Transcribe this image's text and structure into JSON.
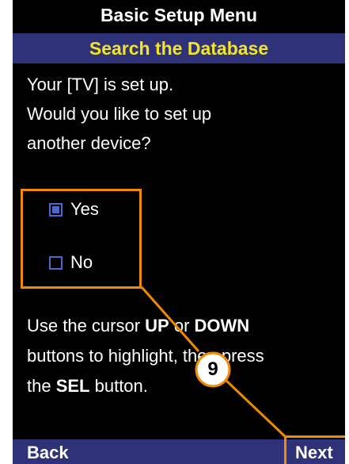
{
  "header": {
    "title": "Basic Setup Menu",
    "subtitle": "Search the Database"
  },
  "message": {
    "lines": [
      "Your [TV] is set up.",
      "Would you like to set up",
      "another device?"
    ]
  },
  "options": [
    {
      "label": "Yes",
      "checked": true
    },
    {
      "label": "No",
      "checked": false
    }
  ],
  "instructions": {
    "line1_pre": "Use the cursor ",
    "line1_up": "UP",
    "line1_mid": " or ",
    "line1_down": "DOWN",
    "line2": "buttons to highlight, then press",
    "line3_pre": "the ",
    "line3_sel": "SEL",
    "line3_post": " button."
  },
  "softkeys": {
    "back": "Back",
    "next": "Next"
  },
  "callout": {
    "number": "9",
    "color": "#f08a00"
  },
  "colors": {
    "screen_bg": "#000000",
    "bar_bg": "#2f3279",
    "subtitle_text": "#f2e526",
    "checkbox": "#4e67c8"
  }
}
